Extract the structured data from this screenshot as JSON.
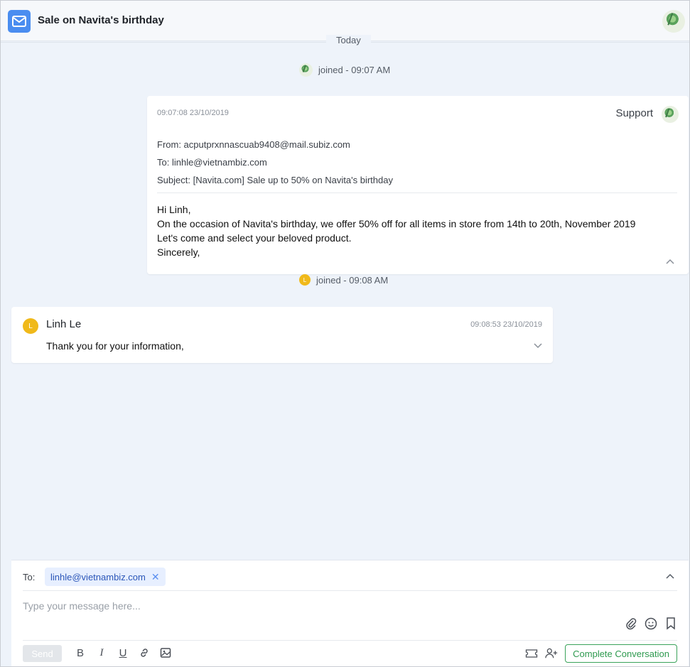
{
  "header": {
    "title": "Sale on Navita's birthday",
    "icon": "mail-icon",
    "avatar": "user-avatar"
  },
  "timeline": {
    "day_label": "Today",
    "events": [
      {
        "text": "joined - 09:07 AM"
      },
      {
        "text": "joined - 09:08 AM",
        "avatar_letter": "L"
      }
    ]
  },
  "email": {
    "time": "09:07:08 23/10/2019",
    "sender": "Support",
    "from": "From: acputprxnnascuab9408@mail.subiz.com",
    "to": "To: linhle@vietnambiz.com",
    "subject": "Subject: [Navita.com] Sale up to 50% on Navita's birthday",
    "body": [
      "Hi Linh,",
      "On the occasion of Navita's birthday, we offer 50% off for all items in store from 14th to 20th, November 2019",
      "Let's come and select your beloved product.",
      "Sincerely,"
    ],
    "toggle_icon": "chevron-up-icon"
  },
  "reply": {
    "avatar_letter": "L",
    "name": "Linh Le",
    "time": "09:08:53 23/10/2019",
    "text": "Thank you for your information,",
    "toggle_icon": "chevron-down-icon"
  },
  "composer": {
    "to_label": "To:",
    "recipient": "linhle@vietnambiz.com",
    "placeholder": "Type your message here...",
    "send_label": "Send",
    "complete_label": "Complete Conversation",
    "format_tools": [
      "bold",
      "italic",
      "underline",
      "link",
      "image"
    ],
    "attach_tools": [
      "attachment",
      "emoji",
      "bookmark"
    ],
    "status_color": "#3aa35a"
  }
}
